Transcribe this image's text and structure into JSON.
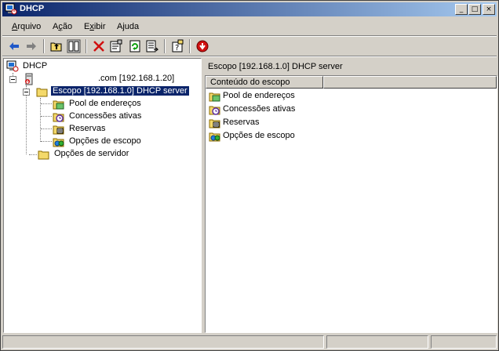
{
  "window": {
    "title": "DHCP",
    "controls": {
      "minimize": "_",
      "maximize": "□",
      "close": "×"
    }
  },
  "menu": [
    {
      "label": "Arquivo",
      "accel": "A",
      "rest": "rquivo"
    },
    {
      "label": "Ação",
      "accel": "ç",
      "pre": "A",
      "rest": "ão"
    },
    {
      "label": "Exibir",
      "accel": "x",
      "pre": "E",
      "rest": "ibir"
    },
    {
      "label": "Ajuda",
      "accel": "j",
      "pre": "A",
      "rest": "uda"
    }
  ],
  "toolbar": {
    "items": [
      "back-icon",
      "forward-icon",
      "up-folder-icon",
      "show-hide-tree-icon",
      "delete-icon",
      "properties-icon",
      "refresh-icon",
      "export-list-icon",
      "help-icon",
      "stop-icon"
    ]
  },
  "tree": {
    "root": "DHCP",
    "server": ".com [192.168.1.20]",
    "scope": "Escopo [192.168.1.0] DHCP server",
    "scope_children": [
      "Pool de endereços",
      "Concessões ativas",
      "Reservas",
      "Opções de escopo"
    ],
    "server_options": "Opções de servidor"
  },
  "details": {
    "header": "Escopo [192.168.1.0] DHCP server",
    "column": "Conteúdo do escopo",
    "items": [
      "Pool de endereços",
      "Concessões ativas",
      "Reservas",
      "Opções de escopo"
    ]
  },
  "colors": {
    "title_gradient_start": "#0a246a",
    "title_gradient_end": "#a6caf0",
    "selection": "#0a246a",
    "face": "#d4d0c8"
  }
}
